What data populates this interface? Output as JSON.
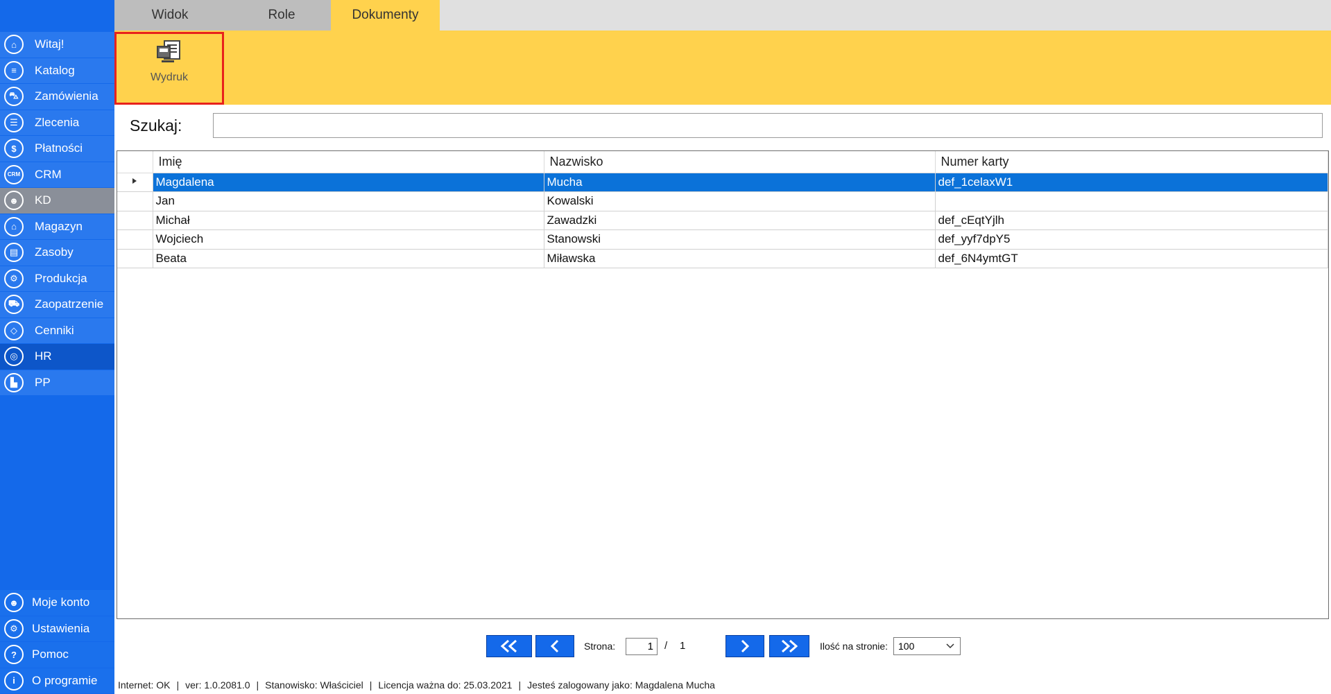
{
  "sidebar": {
    "items": [
      {
        "label": "Witaj!",
        "icon": "home-icon",
        "glyph": "⌂"
      },
      {
        "label": "Katalog",
        "icon": "book-icon",
        "glyph": "≡"
      },
      {
        "label": "Zamówienia",
        "icon": "cart-icon",
        "glyph": "⛍"
      },
      {
        "label": "Zlecenia",
        "icon": "list-icon",
        "glyph": "☰"
      },
      {
        "label": "Płatności",
        "icon": "dollar-icon",
        "glyph": "$"
      },
      {
        "label": "CRM",
        "icon": "crm-icon",
        "glyph": "CRM"
      },
      {
        "label": "KD",
        "icon": "user-icon",
        "glyph": "☻"
      },
      {
        "label": "Magazyn",
        "icon": "warehouse-icon",
        "glyph": "⌂"
      },
      {
        "label": "Zasoby",
        "icon": "box-icon",
        "glyph": "▤"
      },
      {
        "label": "Produkcja",
        "icon": "production-icon",
        "glyph": "⚙"
      },
      {
        "label": "Zaopatrzenie",
        "icon": "truck-icon",
        "glyph": "⛟"
      },
      {
        "label": "Cenniki",
        "icon": "tag-icon",
        "glyph": "◇"
      },
      {
        "label": "HR",
        "icon": "fingerprint-icon",
        "glyph": "◎"
      },
      {
        "label": "PP",
        "icon": "factory-icon",
        "glyph": "▙"
      }
    ],
    "bottom_items": [
      {
        "label": "Moje konto",
        "icon": "account-icon",
        "glyph": "☻"
      },
      {
        "label": "Ustawienia",
        "icon": "settings-icon",
        "glyph": "⚙"
      },
      {
        "label": "Pomoc",
        "icon": "help-icon",
        "glyph": "?"
      },
      {
        "label": "O programie",
        "icon": "info-icon",
        "glyph": "i"
      }
    ]
  },
  "tabs": [
    {
      "label": "Widok"
    },
    {
      "label": "Role"
    },
    {
      "label": "Dokumenty"
    }
  ],
  "ribbon": {
    "print_label": "Wydruk",
    "print_icon": "print-document-icon"
  },
  "search": {
    "label": "Szukaj:",
    "value": ""
  },
  "grid": {
    "columns": [
      "Imię",
      "Nazwisko",
      "Numer karty"
    ],
    "rows": [
      {
        "imie": "Magdalena",
        "nazwisko": "Mucha",
        "karta": "def_1celaxW1"
      },
      {
        "imie": "Jan",
        "nazwisko": "Kowalski",
        "karta": ""
      },
      {
        "imie": "Michał",
        "nazwisko": "Zawadzki",
        "karta": "def_cEqtYjlh"
      },
      {
        "imie": "Wojciech",
        "nazwisko": "Stanowski",
        "karta": "def_yyf7dpY5"
      },
      {
        "imie": "Beata",
        "nazwisko": "Miławska",
        "karta": "def_6N4ymtGT"
      }
    ],
    "selected_row": 0
  },
  "pager": {
    "page_label": "Strona:",
    "current_page": "1",
    "separator": "/",
    "total_pages": "1",
    "per_page_label": "Ilość na stronie:",
    "per_page_value": "100"
  },
  "status": {
    "internet": "Internet: OK",
    "version": "ver: 1.0.2081.0",
    "position": "Stanowisko: Właściciel",
    "license": "Licencja ważna do: 25.03.2021",
    "user": "Jesteś zalogowany jako: Magdalena Mucha"
  },
  "colors": {
    "sidebar": "#1469ea",
    "ribbon": "#ffd24d",
    "selection": "#0b72d9",
    "highlight_border": "#e8221c"
  }
}
